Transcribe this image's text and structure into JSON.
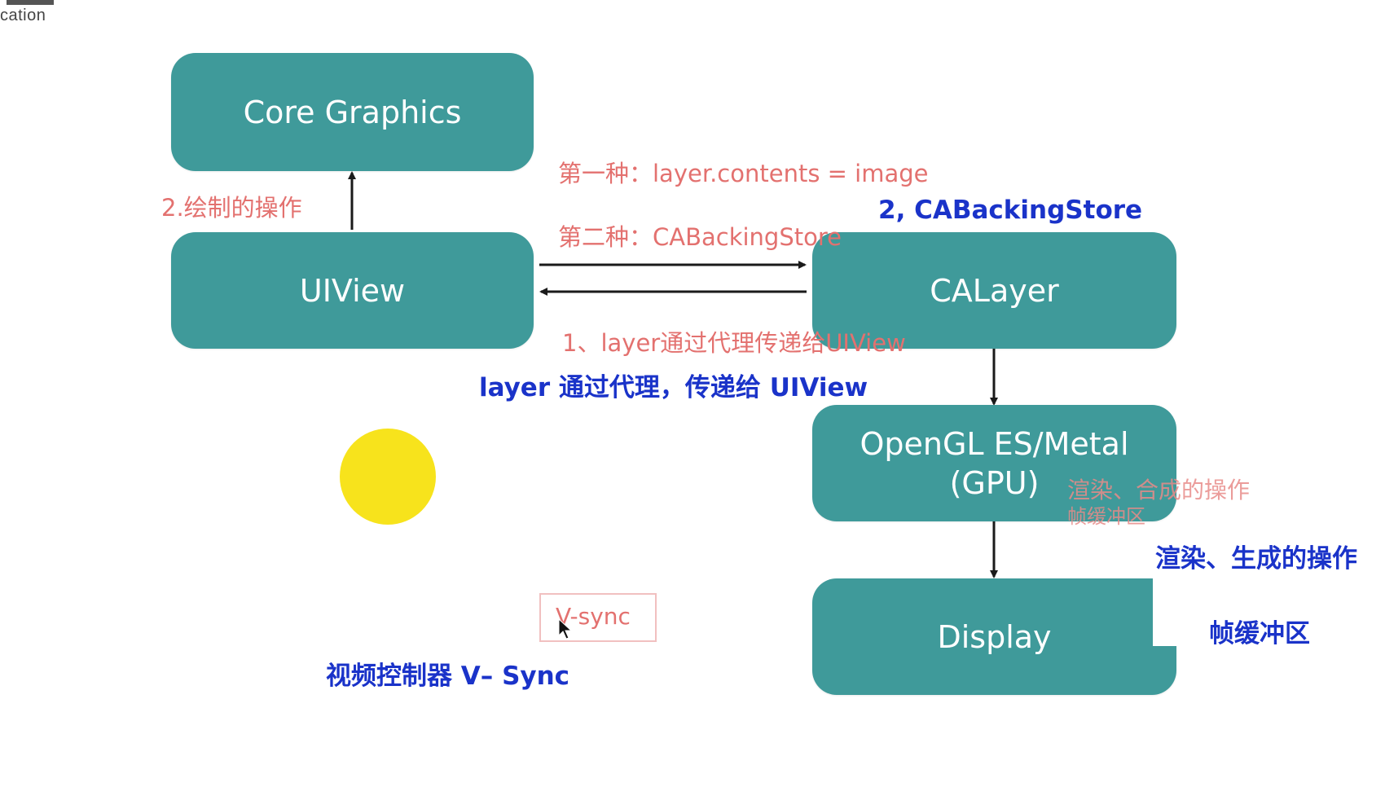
{
  "logo": {
    "text": "cation"
  },
  "boxes": {
    "core_graphics": "Core Graphics",
    "uiview": "UIView",
    "calayer": "CALayer",
    "opengl": "OpenGL ES/Metal\n(GPU)",
    "display": "Display"
  },
  "labels": {
    "draw_op": "2.绘制的操作",
    "method_one": "第一种：layer.contents = image",
    "method_two": "第二种：CABackingStore",
    "delegate_red": "1、layer通过代理传递给UIView",
    "render_red": "渲染、合成的操作",
    "framebuffer_red": "帧缓冲区",
    "vsync": "V-sync"
  },
  "annotations": {
    "cabackingstore": "2, CABackingStore",
    "delegate": "layer 通过代理，传递给 UIView",
    "render": "渲染、生成的操作",
    "framebuffer": "帧缓冲区",
    "vsync_controller": "视频控制器 V– Sync"
  },
  "colors": {
    "box_fill": "#3f9a9a",
    "red_text": "#e3716f",
    "blue_text": "#1a33c9",
    "highlight_circle": "#f7e31c"
  },
  "icons": {
    "cursor": "mouse-pointer-icon",
    "highlight": "cursor-highlight-circle"
  }
}
